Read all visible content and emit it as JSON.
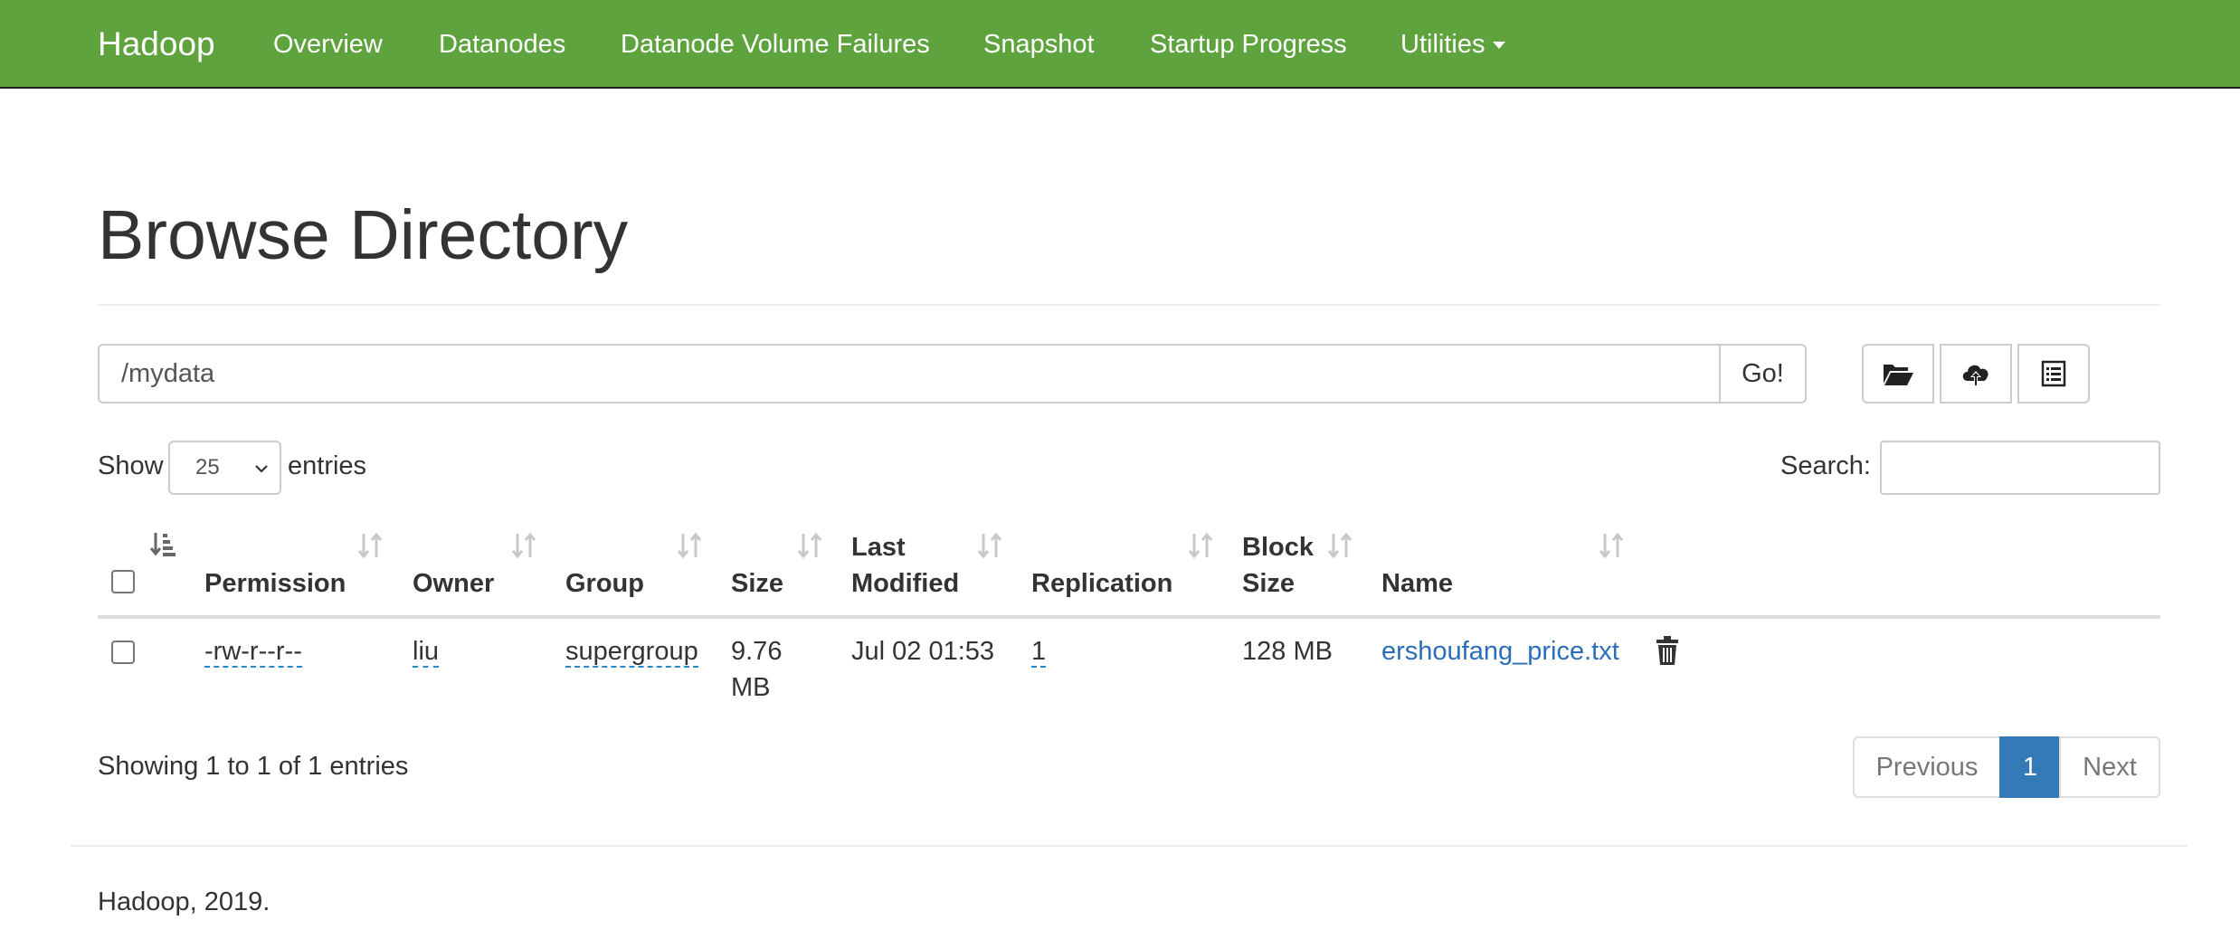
{
  "navbar": {
    "brand": "Hadoop",
    "items": [
      "Overview",
      "Datanodes",
      "Datanode Volume Failures",
      "Snapshot",
      "Startup Progress",
      "Utilities"
    ],
    "background": "#5fa33e"
  },
  "page": {
    "title": "Browse Directory"
  },
  "path_bar": {
    "value": "/mydata",
    "go_label": "Go!",
    "tools": [
      "folder-open-icon",
      "cloud-upload-icon",
      "list-icon"
    ]
  },
  "entries": {
    "show_label": "Show",
    "selected": "25",
    "suffix_label": "entries"
  },
  "search": {
    "label": "Search:",
    "value": ""
  },
  "table": {
    "headers": {
      "permission": "Permission",
      "owner": "Owner",
      "group": "Group",
      "size": "Size",
      "last_modified_1": "Last",
      "last_modified_2": "Modified",
      "replication": "Replication",
      "block_size_1": "Block",
      "block_size_2": "Size",
      "name": "Name"
    },
    "rows": [
      {
        "permission": "-rw-r--r--",
        "owner": "liu",
        "group": "supergroup",
        "size_1": "9.76",
        "size_2": "MB",
        "last_modified": "Jul 02 01:53",
        "replication": "1",
        "block_size": "128 MB",
        "name": "ershoufang_price.txt",
        "delete_icon": "trash-icon"
      }
    ]
  },
  "pagination": {
    "info": "Showing 1 to 1 of 1 entries",
    "previous": "Previous",
    "current": "1",
    "next": "Next",
    "active_color": "#337ab7"
  },
  "footer": {
    "text": "Hadoop, 2019."
  }
}
